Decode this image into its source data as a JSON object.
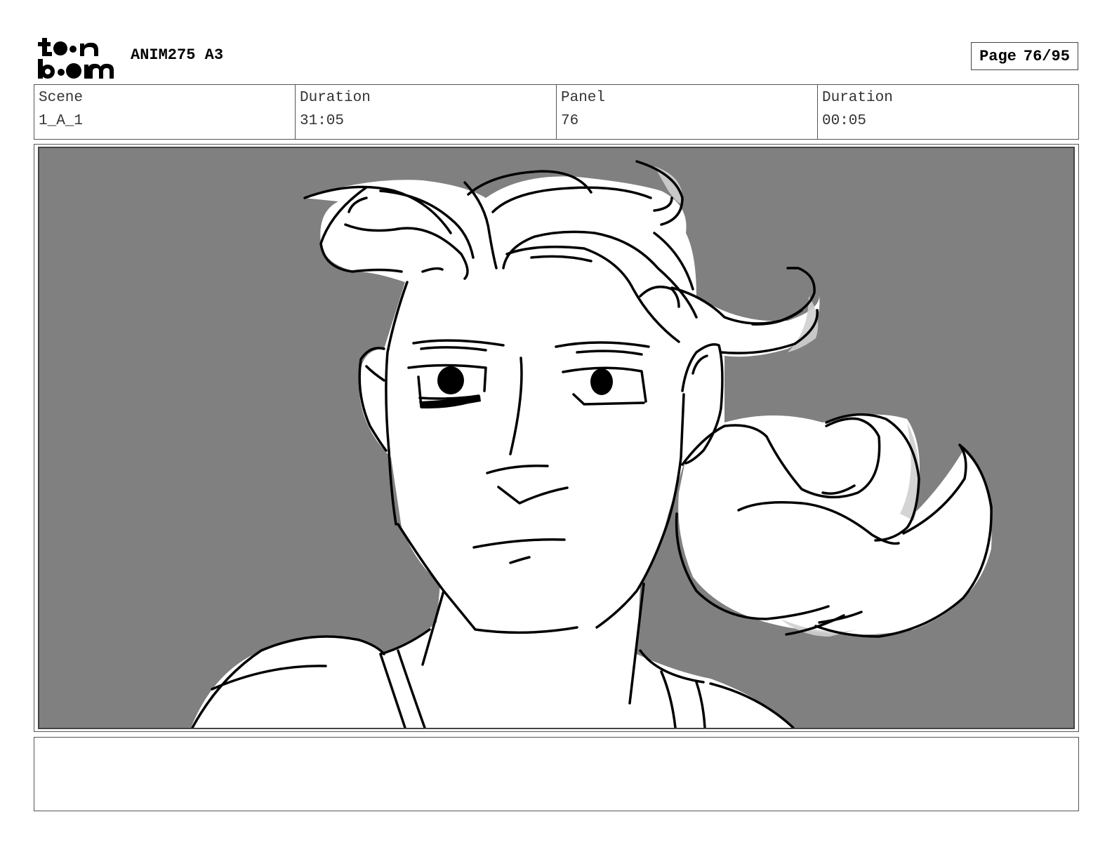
{
  "header": {
    "logo_text": "toon boom",
    "project_title": "ANIM275 A3",
    "page_label": "Page",
    "page_value": "76/95"
  },
  "info": {
    "scene_label": "Scene",
    "scene_value": "1_A_1",
    "scene_duration_label": "Duration",
    "scene_duration_value": "31:05",
    "panel_label": "Panel",
    "panel_value": "76",
    "panel_duration_label": "Duration",
    "panel_duration_value": "00:05"
  },
  "panel": {
    "background_color": "#808080",
    "line_color": "#000000"
  },
  "notes": {
    "text": ""
  }
}
